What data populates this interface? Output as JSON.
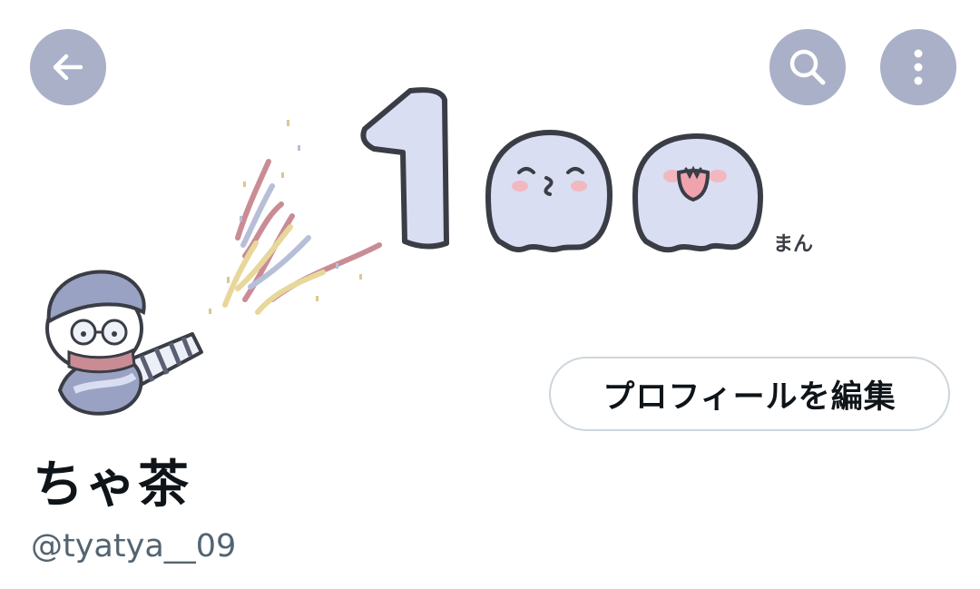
{
  "header": {
    "back_icon": "arrow-left-icon",
    "search_icon": "search-icon",
    "more_icon": "more-vertical-icon",
    "button_color": "#a9b0c8"
  },
  "banner": {
    "number_text": "1",
    "unit_text": "まん"
  },
  "profile": {
    "edit_button_label": "プロフィールを編集",
    "display_name": "ちゃ茶",
    "handle": "@tyatya__09"
  }
}
